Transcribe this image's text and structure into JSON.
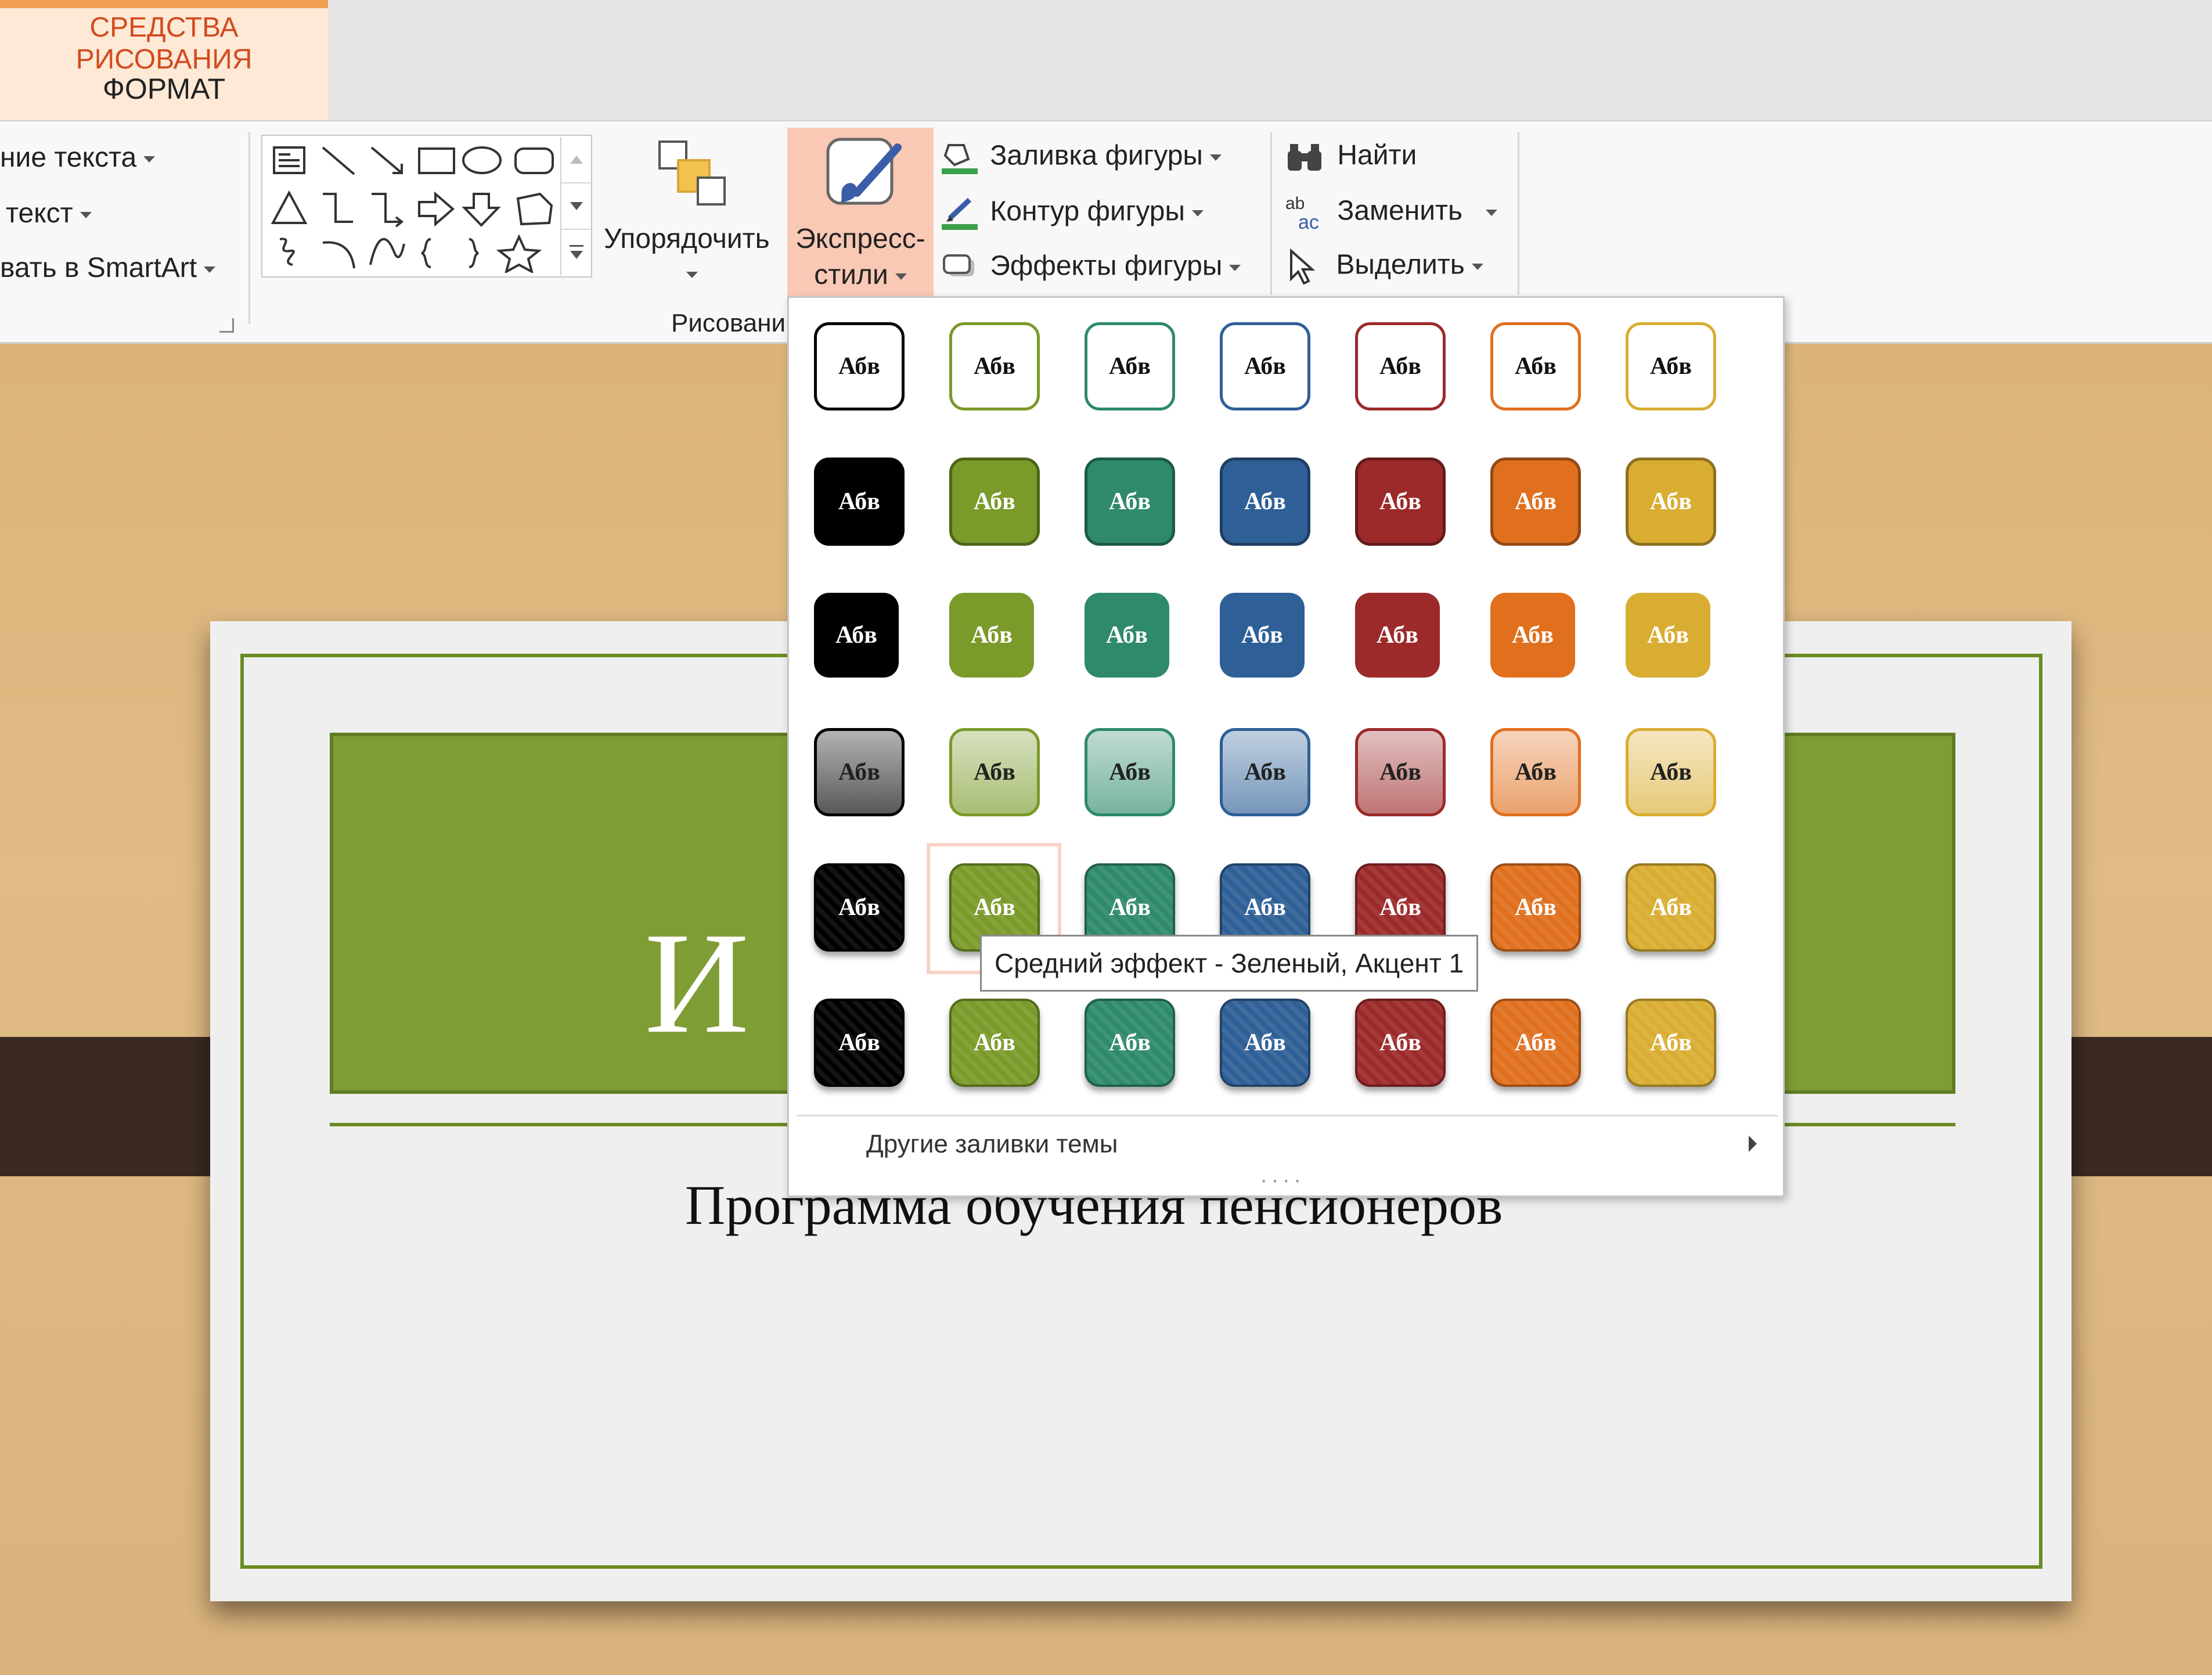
{
  "tabs": {
    "context_title": "СРЕДСТВА РИСОВАНИЯ",
    "format": "ФОРМАТ"
  },
  "ribbon": {
    "text_group": {
      "item1": "ние текста",
      "item2": "текст",
      "item3": "вать в SmartArt"
    },
    "arrange_label": "Упорядочить",
    "quick_styles_label1": "Экспресс-",
    "quick_styles_label2": "стили",
    "shape_fill": "Заливка фигуры",
    "shape_outline": "Контур фигуры",
    "shape_effects": "Эффекты фигуры",
    "find": "Найти",
    "replace": "Заменить",
    "select": "Выделить",
    "drawing_group_label": "Рисовани"
  },
  "quick_styles": {
    "swatch_text": "Абв",
    "colors": [
      "#000000",
      "#7a9a2a",
      "#2e8a6a",
      "#2e5f96",
      "#9c2a2a",
      "#e0701e",
      "#d9ad32"
    ],
    "more_fills": "Другие заливки темы",
    "tooltip": "Средний эффект - Зеленый, Акцент 1"
  },
  "slide": {
    "title_visible": "И",
    "subtitle": "Программа обучения пенсионеров"
  }
}
